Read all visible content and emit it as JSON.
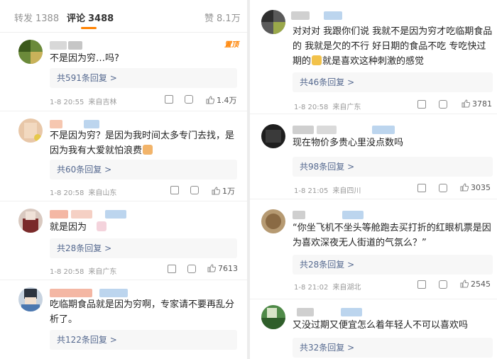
{
  "tabs": {
    "repost_label": "转发",
    "repost_count": "1388",
    "comments_label": "评论",
    "comments_count": "3488",
    "likes_label": "赞",
    "likes_count": "8.1万"
  },
  "badge_text": "置顶",
  "left_comments": [
    {
      "text": "不是因为穷…吗?",
      "replies": "共591条回复 >",
      "time": "1-8 20:55",
      "source": "来自吉林",
      "likes": "1.4万"
    },
    {
      "text": "不是因为穷？是因为我时间太多专门去找，是因为我有大爱就怕浪费",
      "replies": "共60条回复 >",
      "time": "1-8 20:58",
      "source": "来自山东",
      "likes": "1万"
    },
    {
      "text": "就是因为",
      "replies": "共28条回复 >",
      "time": "1-8 20:58",
      "source": "来自广东",
      "likes": "7613"
    },
    {
      "text": "吃临期食品就是因为穷啊，专家请不要再乱分析了。",
      "replies": "共122条回复 >",
      "time": "",
      "source": "",
      "likes": ""
    }
  ],
  "right_comments": [
    {
      "text_a": "对对对 我跟你们说 我就不是因为穷才吃临期食品的 我就是欠的不行 好日期的食品不吃 专吃快过期的",
      "text_b": "就是喜欢这种刺激的感觉",
      "replies": "共46条回复 >",
      "time": "1-8 20:58",
      "source": "来自广东",
      "likes": "3781"
    },
    {
      "text": "现在物价多贵心里没点数吗",
      "replies": "共98条回复 >",
      "time": "1-8 21:05",
      "source": "来自四川",
      "likes": "3035"
    },
    {
      "text": "“你坐飞机不坐头等舱跑去买打折的红眼机票是因为喜欢深夜无人街道的气氛么？”",
      "replies": "共28条回复 >",
      "time": "1-8 21:02",
      "source": "来自湖北",
      "likes": "2545"
    },
    {
      "text": "又没过期又便宜怎么着年轻人不可以喜欢吗",
      "replies": "共32条回复 >",
      "time": "",
      "source": "",
      "likes": ""
    }
  ],
  "colors": {
    "accent": "#ff8200",
    "reply_link": "#55698f",
    "meta": "#9a9a9a"
  }
}
